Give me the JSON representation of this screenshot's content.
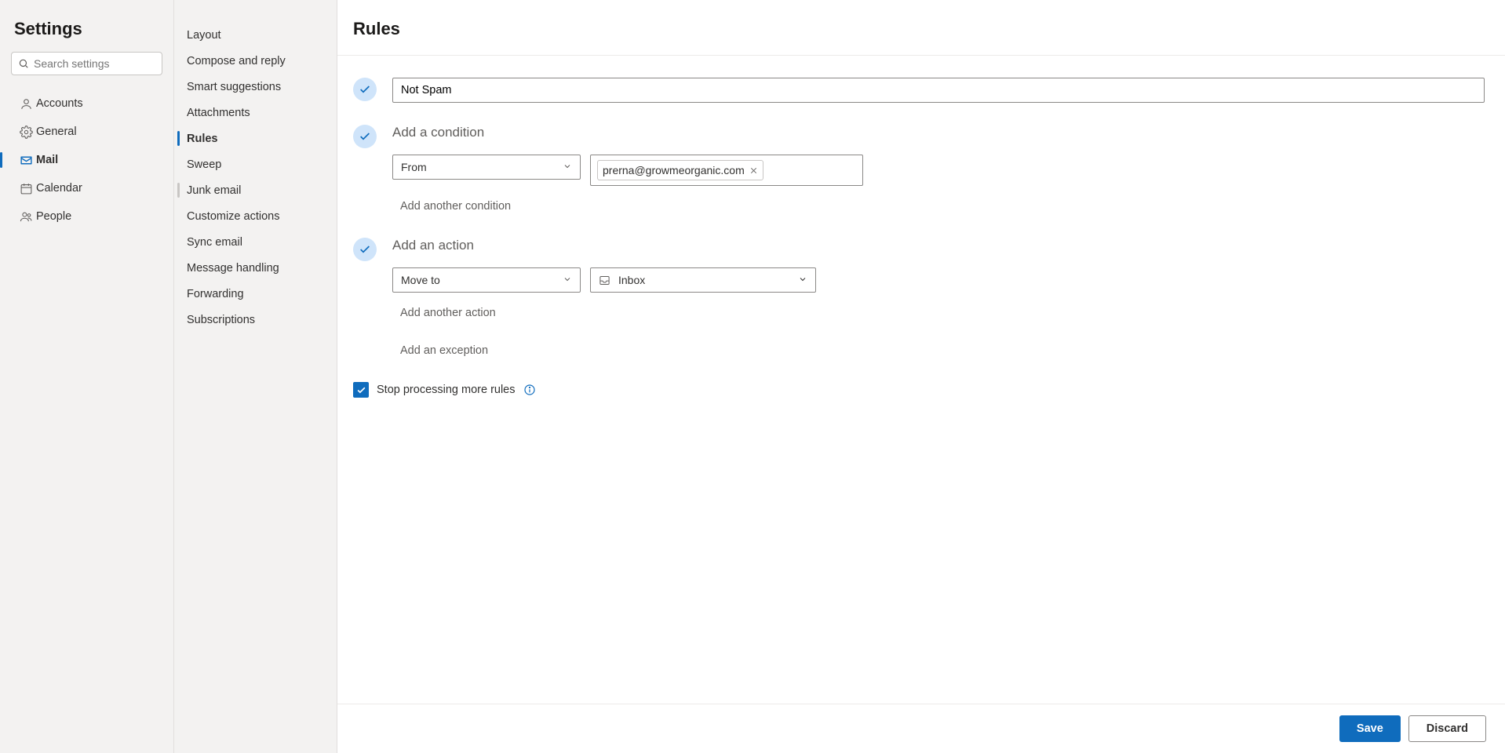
{
  "settings_title": "Settings",
  "search": {
    "placeholder": "Search settings"
  },
  "nav": {
    "accounts": "Accounts",
    "general": "General",
    "mail": "Mail",
    "calendar": "Calendar",
    "people": "People"
  },
  "subnav": {
    "layout": "Layout",
    "compose": "Compose and reply",
    "smart": "Smart suggestions",
    "attachments": "Attachments",
    "rules": "Rules",
    "sweep": "Sweep",
    "junk": "Junk email",
    "customize": "Customize actions",
    "sync": "Sync email",
    "msg_handling": "Message handling",
    "forwarding": "Forwarding",
    "subscriptions": "Subscriptions"
  },
  "page": {
    "title": "Rules",
    "rule_name": "Not Spam",
    "add_condition": "Add a condition",
    "condition_field": "From",
    "condition_value": "prerna@growmeorganic.com",
    "add_another_condition": "Add another condition",
    "add_action": "Add an action",
    "action_field": "Move to",
    "action_folder": "Inbox",
    "add_another_action": "Add another action",
    "add_exception": "Add an exception",
    "stop_processing": "Stop processing more rules"
  },
  "footer": {
    "save": "Save",
    "discard": "Discard"
  }
}
